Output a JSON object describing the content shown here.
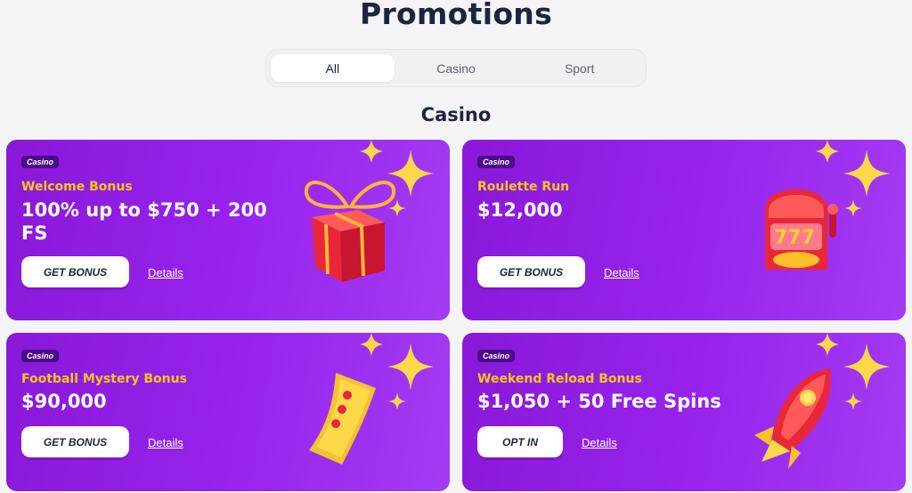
{
  "page": {
    "title": "Promotions"
  },
  "tabs": [
    {
      "label": "All",
      "active": true
    },
    {
      "label": "Casino",
      "active": false
    },
    {
      "label": "Sport",
      "active": false
    }
  ],
  "section": {
    "title": "Casino"
  },
  "promotions": [
    {
      "badge": "Casino",
      "name": "Welcome Bonus",
      "value": "100% up to $750 + 200 FS",
      "cta": "GET BONUS",
      "details": "Details",
      "art": "gift-box-icon"
    },
    {
      "badge": "Casino",
      "name": "Roulette Run",
      "value": "$12,000",
      "cta": "GET BONUS",
      "details": "Details",
      "art": "slot-machine-icon"
    },
    {
      "badge": "Casino",
      "name": "Football Mystery Bonus",
      "value": "$90,000",
      "cta": "GET BONUS",
      "details": "Details",
      "art": "ticket-icon"
    },
    {
      "badge": "Casino",
      "name": "Weekend Reload Bonus",
      "value": "$1,050 + 50 Free Spins",
      "cta": "OPT IN",
      "details": "Details",
      "art": "rocket-icon"
    }
  ],
  "colors": {
    "card_gradient_start": "#8a18d8",
    "card_gradient_end": "#a33bf2",
    "promo_name": "#ffc51a",
    "badge_bg": "#4b0a87",
    "heading": "#1b2540"
  }
}
